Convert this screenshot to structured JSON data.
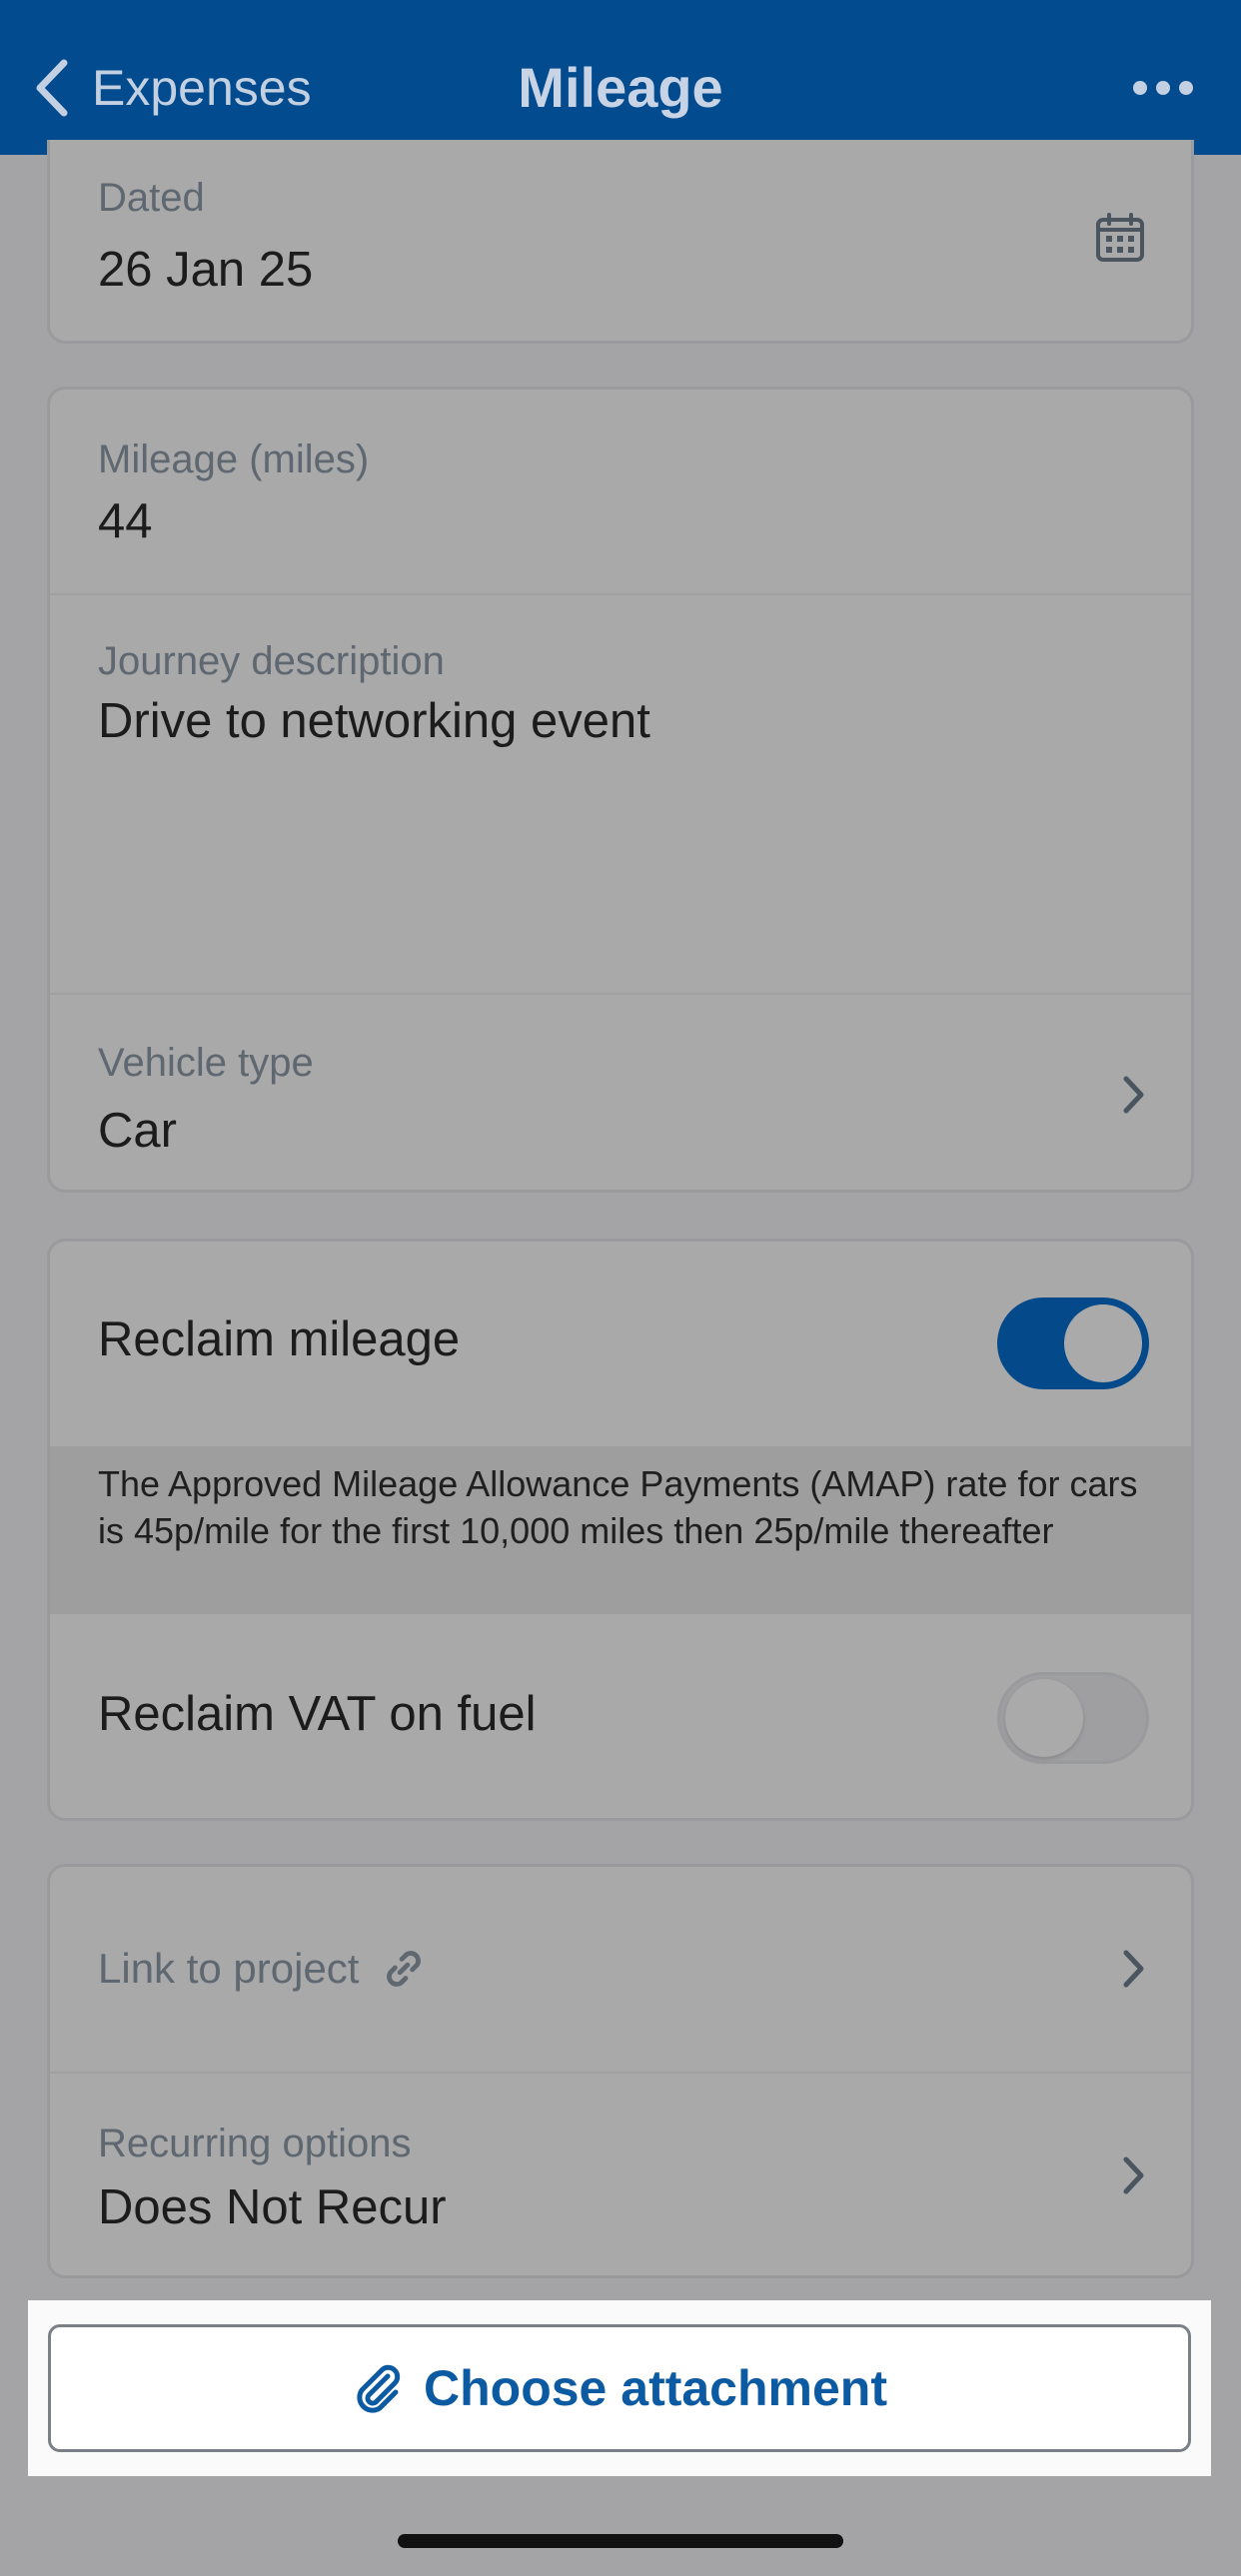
{
  "navbar": {
    "back_label": "Expenses",
    "title": "Mileage",
    "more_icon": "ellipsis-icon",
    "color": "#024b8e"
  },
  "dated": {
    "label": "Dated",
    "value": "26 Jan 25",
    "icon": "calendar-icon"
  },
  "mileage": {
    "label": "Mileage (miles)",
    "value": "44"
  },
  "journey": {
    "label": "Journey description",
    "value": "Drive to networking event"
  },
  "vehicle": {
    "label": "Vehicle type",
    "value": "Car"
  },
  "reclaim_mileage": {
    "label": "Reclaim mileage",
    "enabled": true
  },
  "amap_info": "The Approved Mileage Allowance Payments (AMAP) rate for cars is 45p/mile for the first 10,000 miles then 25p/mile thereafter",
  "reclaim_vat": {
    "label": "Reclaim VAT on fuel",
    "enabled": false
  },
  "project": {
    "label": "Link to project",
    "icon": "link-icon"
  },
  "recurring": {
    "label": "Recurring options",
    "value": "Does Not Recur"
  },
  "attachment": {
    "label": "Choose attachment",
    "icon": "paperclip-icon",
    "accent": "#0b5aa2"
  }
}
